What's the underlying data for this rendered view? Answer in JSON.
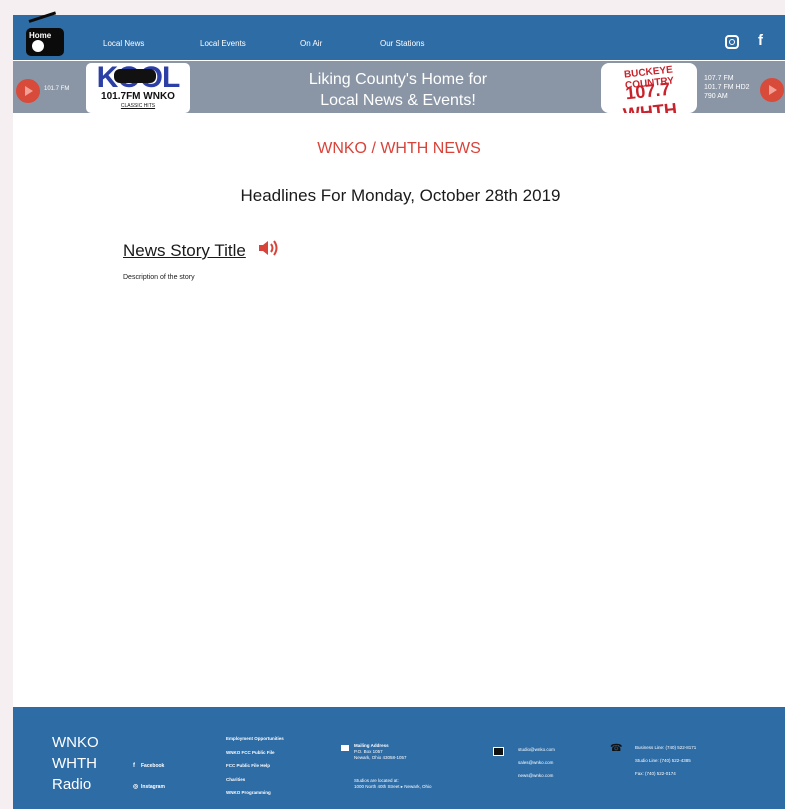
{
  "nav": {
    "home_label": "Home",
    "links": [
      "Local News",
      "Local Events",
      "On Air",
      "Our Stations"
    ]
  },
  "banner": {
    "left_freq": "101.7 FM",
    "kool_word": "KOOL",
    "kool_sub": "101.7FM  WNKO",
    "kool_tag": "CLASSIC HITS",
    "tagline_1": "Liking County's Home for",
    "tagline_2": "Local News & Events!",
    "buckeye_top": "BUCKEYE COUNTRY",
    "buckeye_main": "107.7 WHTH",
    "right_freqs": [
      "107.7 FM",
      "101.7 FM HD2",
      "790 AM"
    ]
  },
  "content": {
    "section_title": "WNKO / WHTH NEWS",
    "headline_date": "Headlines For Monday, October 28th 2019",
    "story_title": "News Story Title",
    "story_desc": "Description of the story"
  },
  "footer": {
    "brand": [
      "WNKO",
      "WHTH",
      "Radio"
    ],
    "social": [
      "Facebook",
      "Instagram"
    ],
    "links": [
      "Employment Opportunities",
      "WNKO FCC Public File",
      "FCC Public File Help",
      "Charities",
      "WNKO Programming"
    ],
    "mailing_title": "Mailing Address",
    "mailing_lines": [
      "P.O. Box 1057",
      "Newark, Ohio 43058-1057"
    ],
    "studio_lines": [
      "Studios are located at:",
      "1000 North 40th Street ▸ Newark, Ohio"
    ],
    "emails": [
      "studio@wnko.com",
      "sales@wnko.com",
      "news@wnko.com"
    ],
    "phones": [
      "Business Line: (740) 522-8171",
      "Studio Line: (740) 522-4385",
      "Fax: (740) 522-0174"
    ]
  },
  "colors": {
    "nav_blue": "#2e6ca6",
    "banner_gray": "#8a96a6",
    "accent_red": "#d8433a"
  }
}
